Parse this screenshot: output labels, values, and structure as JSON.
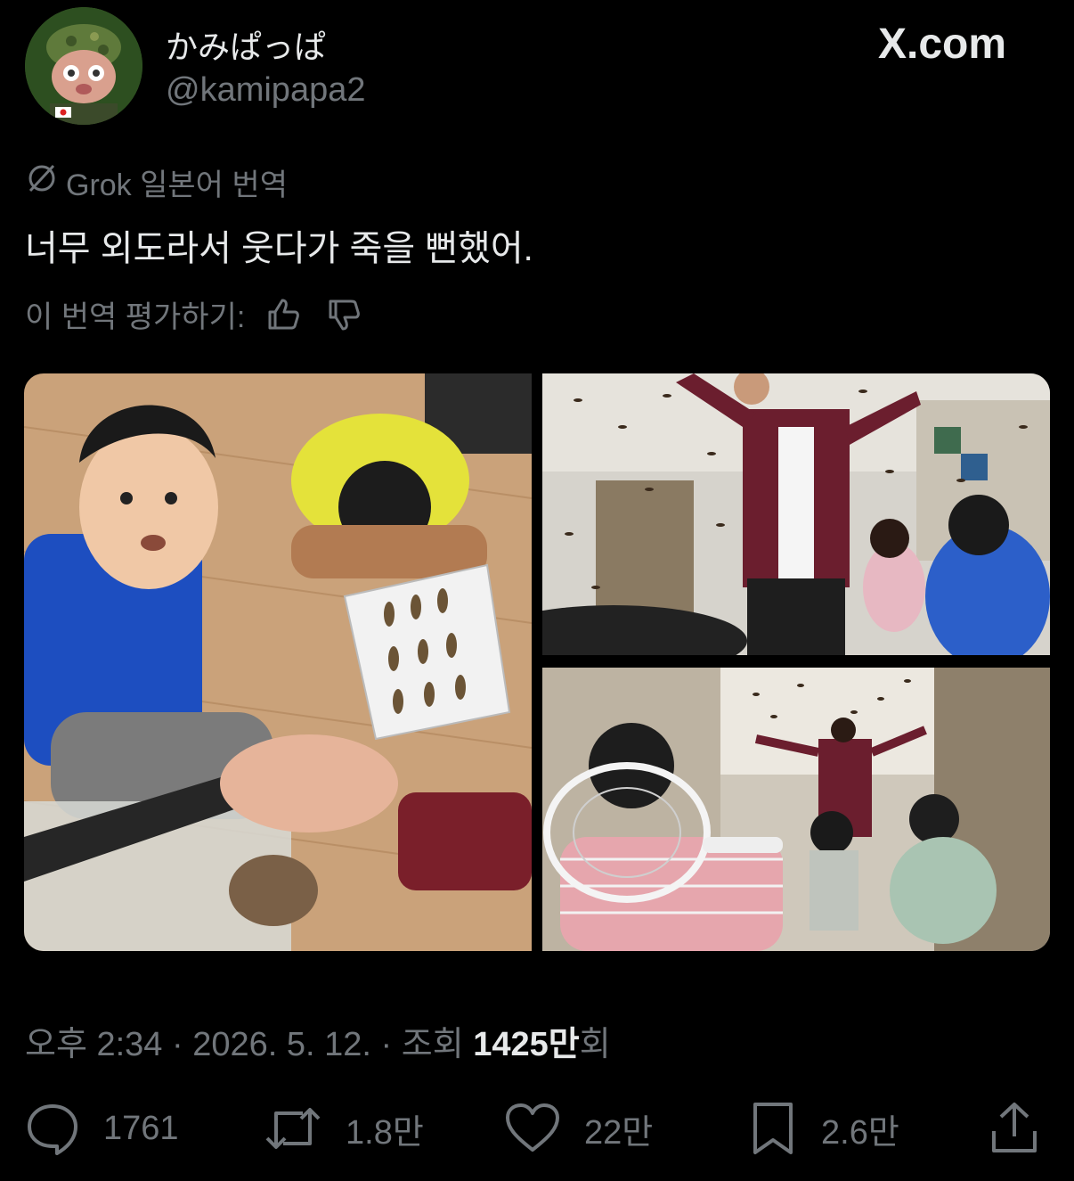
{
  "author": {
    "display_name": "かみぱっぱ",
    "handle": "@kamipapa2",
    "avatar_icon": "rabbit-soldier-avatar"
  },
  "brand": {
    "logo_text": "X.com"
  },
  "translation": {
    "label": "Grok 일본어 번역",
    "icon": "grok-icon",
    "text": "너무 외도라서 웃다가 죽을 뻔했어.",
    "rate_label": "이 번역 평가하기:",
    "like_icon": "thumbs-up-icon",
    "dislike_icon": "thumbs-down-icon"
  },
  "media": {
    "count": 3,
    "photos": [
      "photo-boy-insect-specimens",
      "photo-classroom-teacher-crickets",
      "photo-hallway-kids-running"
    ]
  },
  "meta": {
    "time": "오후 2:34",
    "separator": " · ",
    "date": "2026. 5. 12.",
    "views_label": "조회",
    "views_count": "1425만",
    "views_suffix": "회"
  },
  "actions": {
    "reply_count": "1761",
    "repost_count": "1.8만",
    "like_count": "22만",
    "bookmark_count": "2.6만"
  },
  "colors": {
    "background": "#000000",
    "text_primary": "#e7e9ea",
    "text_secondary": "#71767b"
  }
}
